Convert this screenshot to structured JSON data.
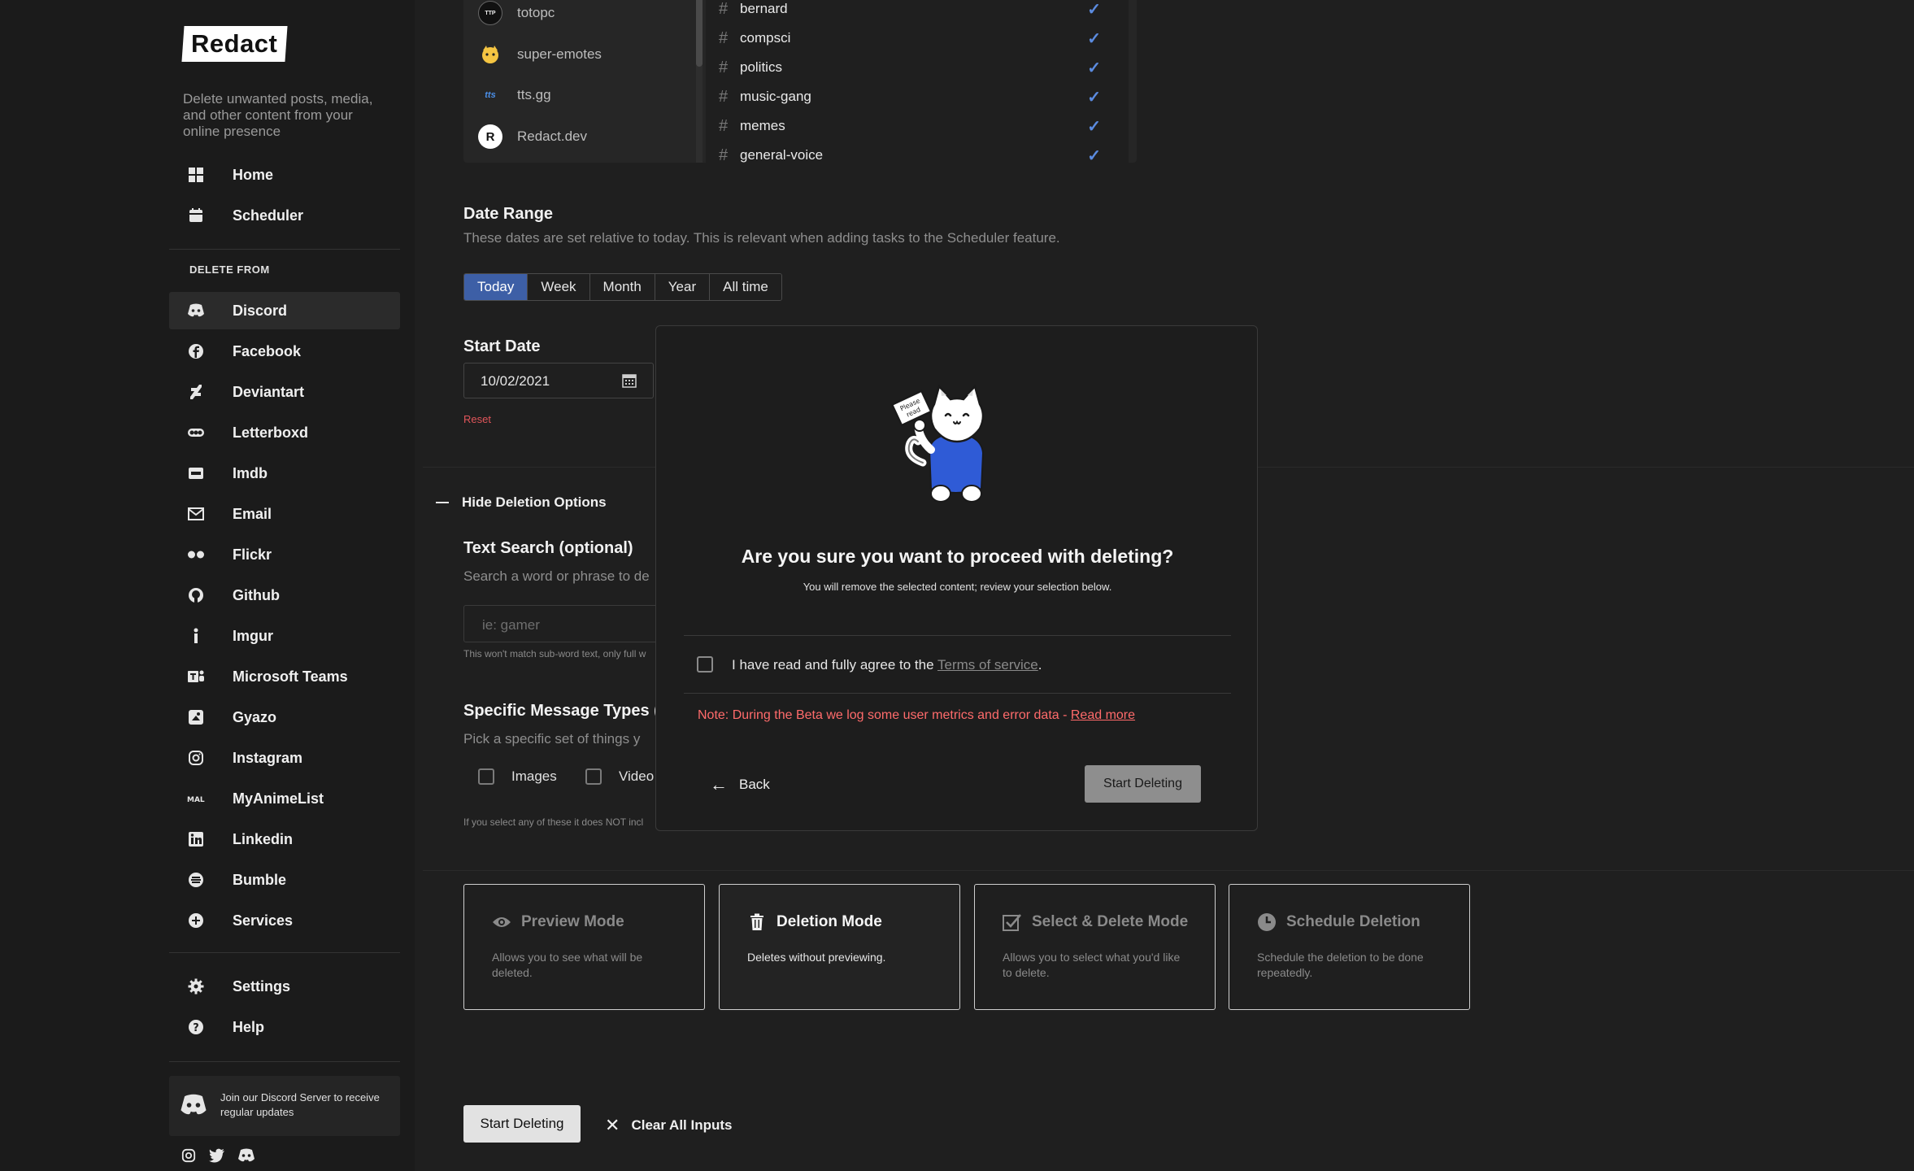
{
  "sidebar": {
    "logo": "Redact",
    "tagline": "Delete unwanted posts, media, and other content from your online presence",
    "nav_top": [
      {
        "label": "Home",
        "icon": "grid-icon"
      },
      {
        "label": "Scheduler",
        "icon": "calendar-icon"
      }
    ],
    "section_title": "DELETE FROM",
    "services": [
      {
        "label": "Discord",
        "icon": "discord-icon"
      },
      {
        "label": "Facebook",
        "icon": "facebook-icon"
      },
      {
        "label": "Deviantart",
        "icon": "deviantart-icon"
      },
      {
        "label": "Letterboxd",
        "icon": "letterboxd-icon"
      },
      {
        "label": "Imdb",
        "icon": "imdb-icon"
      },
      {
        "label": "Email",
        "icon": "mail-icon"
      },
      {
        "label": "Flickr",
        "icon": "flickr-icon"
      },
      {
        "label": "Github",
        "icon": "github-icon"
      },
      {
        "label": "Imgur",
        "icon": "imgur-icon"
      },
      {
        "label": "Microsoft Teams",
        "icon": "teams-icon"
      },
      {
        "label": "Gyazo",
        "icon": "gyazo-icon"
      },
      {
        "label": "Instagram",
        "icon": "instagram-icon"
      },
      {
        "label": "MyAnimeList",
        "icon": "myanimelist-icon"
      },
      {
        "label": "Linkedin",
        "icon": "linkedin-icon"
      },
      {
        "label": "Bumble",
        "icon": "bumble-icon"
      },
      {
        "label": "Services",
        "icon": "plus-circle-icon"
      }
    ],
    "nav_bottom": [
      {
        "label": "Settings",
        "icon": "gear-icon"
      },
      {
        "label": "Help",
        "icon": "help-icon"
      }
    ],
    "join_text": "Join our Discord Server to receive regular updates"
  },
  "servers": [
    {
      "name": "totopc",
      "initial": "TTP"
    },
    {
      "name": "super-emotes",
      "initial": ""
    },
    {
      "name": "tts.gg",
      "initial": "tts"
    },
    {
      "name": "Redact.dev",
      "initial": "R"
    }
  ],
  "channels": [
    "bernard",
    "compsci",
    "politics",
    "music-gang",
    "memes",
    "general-voice"
  ],
  "date_range": {
    "title": "Date Range",
    "subtitle": "These dates are set relative to today. This is relevant when adding tasks to the Scheduler feature.",
    "tabs": [
      "Today",
      "Week",
      "Month",
      "Year",
      "All time"
    ],
    "active_tab": "Today"
  },
  "start_date": {
    "title": "Start Date",
    "value": "10/02/2021",
    "reset": "Reset"
  },
  "options": {
    "toggle_label": "Hide Deletion Options",
    "text_search_title": "Text Search (optional)",
    "text_search_sub": "Search a word or phrase to de",
    "text_search_placeholder": "ie: gamer",
    "text_search_hint": "This won't match sub-word text, only full w",
    "msg_types_title": "Specific Message Types (op",
    "msg_types_sub": "Pick a specific set of things y",
    "type_images": "Images",
    "type_video": "Video",
    "msg_types_hint": "If you select any of these it does NOT incl"
  },
  "modes": [
    {
      "title": "Preview Mode",
      "desc": "Allows you to see what will be deleted.",
      "icon": "eye-icon",
      "active": false
    },
    {
      "title": "Deletion Mode",
      "desc": "Deletes without previewing.",
      "icon": "trash-icon",
      "active": true
    },
    {
      "title": "Select & Delete Mode",
      "desc": "Allows you to select what you'd like to delete.",
      "icon": "checkbox-icon",
      "active": false
    },
    {
      "title": "Schedule Deletion",
      "desc": "Schedule the deletion to be done repeatedly.",
      "icon": "clock-icon",
      "active": false
    }
  ],
  "actions": {
    "start": "Start Deleting",
    "clear": "Clear All Inputs"
  },
  "modal": {
    "title": "Are you sure you want to proceed with deleting?",
    "subtitle": "You will remove the selected content; review your selection below.",
    "tos_prefix": "I have read and fully agree to the ",
    "tos_link": "Terms of service",
    "tos_suffix": ".",
    "note_prefix": "Note: During the Beta we log some user metrics and error data - ",
    "note_link": "Read more",
    "back": "Back",
    "start": "Start Deleting",
    "sign_text": "Please read"
  },
  "colors": {
    "accent": "#3d5fa6",
    "check": "#5b8be0",
    "danger": "#ff6b6b"
  }
}
